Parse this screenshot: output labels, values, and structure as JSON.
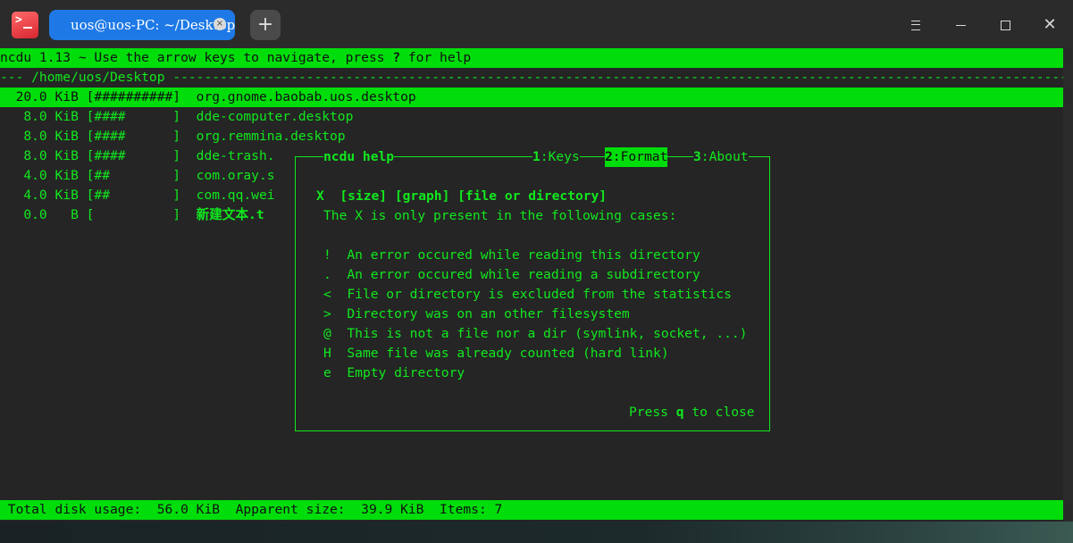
{
  "window": {
    "tab_title": "uos@uos-PC: ~/Desktop",
    "tab_close_glyph": "×",
    "new_tab_glyph": "+",
    "close_glyph": "✕",
    "app_icon_glyph": ">"
  },
  "ncdu": {
    "header": "ncdu 1.13 ~ Use the arrow keys to navigate, press ",
    "header_key": "?",
    "header_tail": " for help",
    "path_line": "--- /home/uos/Desktop ------------------------------------------------------------------------------------------------------------------",
    "rows": [
      {
        "size": "  20.0 KiB [##########]  ",
        "name": "org.gnome.baobab.uos.desktop"
      },
      {
        "size": "   8.0 KiB [####      ]  ",
        "name": "dde-computer.desktop"
      },
      {
        "size": "   8.0 KiB [####      ]  ",
        "name": "org.remmina.desktop"
      },
      {
        "size": "   8.0 KiB [####      ]  ",
        "name": "dde-trash."
      },
      {
        "size": "   4.0 KiB [##        ]  ",
        "name": "com.oray.s"
      },
      {
        "size": "   4.0 KiB [##        ]  ",
        "name": "com.qq.wei"
      },
      {
        "size": "   0.0   B [          ]  ",
        "name": "新建文本.t"
      }
    ],
    "status_bar": " Total disk usage:  56.0 KiB  Apparent size:  39.9 KiB  Items: 7"
  },
  "help": {
    "title": "ncdu help",
    "tab1_num": "1",
    "tab1_label": ":Keys",
    "tab2_num": "2",
    "tab2_label": ":Format",
    "tab3_num": "3",
    "tab3_label": ":About",
    "format_line": "X  [size] [graph] [file or directory]",
    "intro": "The X is only present in the following cases:",
    "cases": [
      {
        "flag": "!",
        "desc": "An error occured while reading this directory"
      },
      {
        "flag": ".",
        "desc": "An error occured while reading a subdirectory"
      },
      {
        "flag": "<",
        "desc": "File or directory is excluded from the statistics"
      },
      {
        "flag": ">",
        "desc": "Directory was on an other filesystem"
      },
      {
        "flag": "@",
        "desc": "This is not a file nor a dir (symlink, socket, ...)"
      },
      {
        "flag": "H",
        "desc": "Same file was already counted (hard link)"
      },
      {
        "flag": "e",
        "desc": "Empty directory"
      }
    ],
    "close_prefix": "Press ",
    "close_key": "q",
    "close_suffix": " to close"
  },
  "colors": {
    "terminal_green": "#11e81e",
    "highlight_green": "#00dd0b",
    "tab_blue": "#1e79e6",
    "background": "#252525"
  }
}
